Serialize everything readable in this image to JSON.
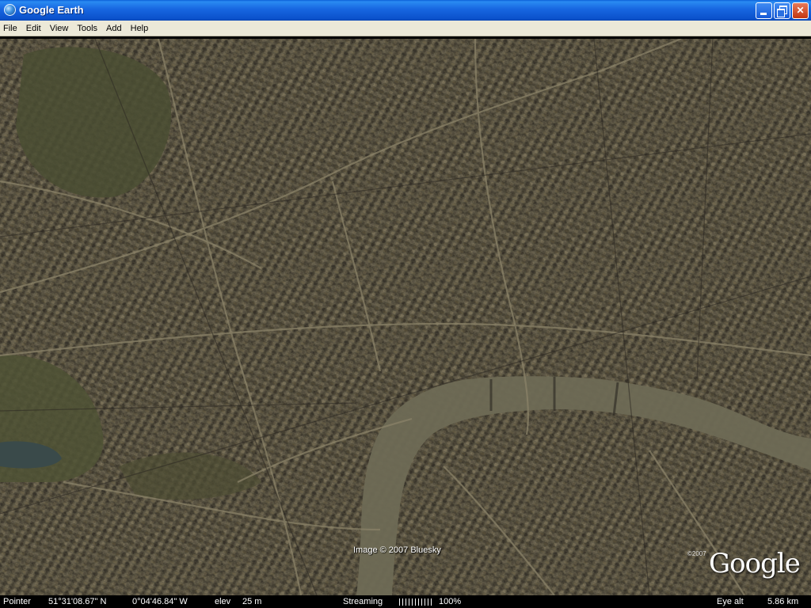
{
  "window": {
    "title": "Google Earth",
    "controls": {
      "minimize": "",
      "maximize": "",
      "close": "✕"
    }
  },
  "menu": [
    "File",
    "Edit",
    "View",
    "Tools",
    "Add",
    "Help"
  ],
  "map": {
    "attribution": "Image © 2007 Bluesky",
    "logo_text": "Google",
    "logo_copyright": "©2007"
  },
  "status": {
    "pointer_label": "Pointer",
    "latitude": "51°31'08.67\" N",
    "longitude": "0°04'46.84\" W",
    "elev_label": "elev",
    "elev_value": "25 m",
    "streaming_label": "Streaming",
    "streaming_percent": "100%",
    "eye_alt_label": "Eye alt",
    "eye_alt_value": "5.86 km"
  },
  "colors": {
    "titlebar": "#1766e0",
    "menubar": "#ece9d8",
    "river": "#6e6a55",
    "city": "#5c5644",
    "park": "#4a4d33",
    "statusbar": "#000000"
  }
}
